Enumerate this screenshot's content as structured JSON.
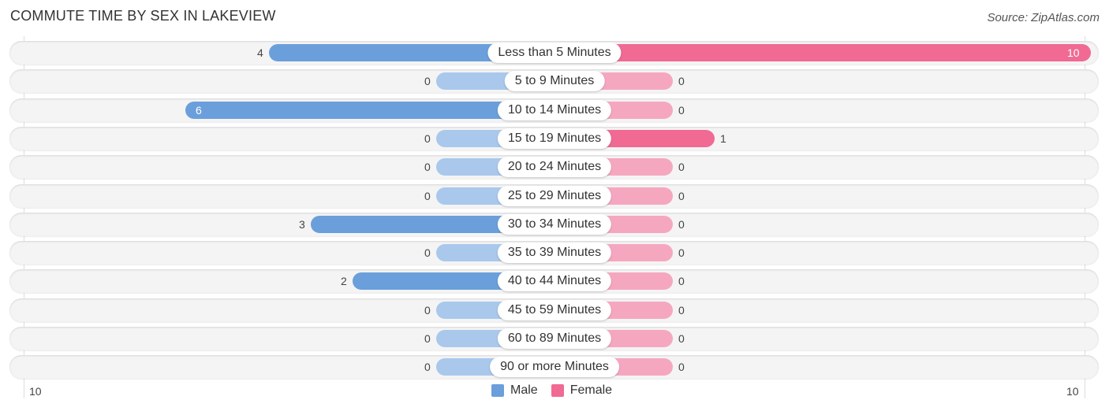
{
  "chart_data": {
    "type": "bar",
    "orientation": "horizontal-diverging",
    "title": "COMMUTE TIME BY SEX IN LAKEVIEW",
    "source": "Source: ZipAtlas.com",
    "categories": [
      "Less than 5 Minutes",
      "5 to 9 Minutes",
      "10 to 14 Minutes",
      "15 to 19 Minutes",
      "20 to 24 Minutes",
      "25 to 29 Minutes",
      "30 to 34 Minutes",
      "35 to 39 Minutes",
      "40 to 44 Minutes",
      "45 to 59 Minutes",
      "60 to 89 Minutes",
      "90 or more Minutes"
    ],
    "series": [
      {
        "name": "Male",
        "color": "#6a9fdb",
        "values": [
          4,
          0,
          6,
          0,
          0,
          0,
          3,
          0,
          2,
          0,
          0,
          0
        ]
      },
      {
        "name": "Female",
        "color": "#f06a93",
        "values": [
          10,
          0,
          0,
          1,
          0,
          0,
          0,
          0,
          0,
          0,
          0,
          0
        ]
      }
    ],
    "axis": {
      "left_tick": "10",
      "right_tick": "10",
      "range": [
        0,
        10
      ]
    },
    "legend": {
      "position": "bottom-center",
      "items": [
        "Male",
        "Female"
      ]
    }
  }
}
